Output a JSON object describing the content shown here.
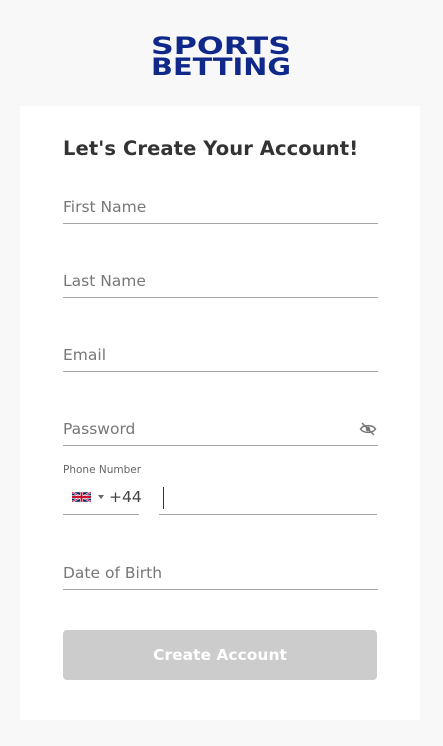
{
  "brand": {
    "logo_text_line1": "SPORTS",
    "logo_text_line2": "BETTING",
    "color": "#10288A"
  },
  "form": {
    "title": "Let's Create Your Account!",
    "fields": {
      "first_name": {
        "placeholder": "First Name",
        "value": ""
      },
      "last_name": {
        "placeholder": "Last Name",
        "value": ""
      },
      "email": {
        "placeholder": "Email",
        "value": ""
      },
      "password": {
        "placeholder": "Password",
        "value": "",
        "toggle_icon": "eye-slash-icon"
      },
      "phone": {
        "label": "Phone Number",
        "country_code": "+44",
        "country_flag_icon": "uk-flag-icon",
        "value": ""
      },
      "date_of_birth": {
        "placeholder": "Date of Birth",
        "value": ""
      }
    },
    "submit_label": "Create Account",
    "submit_color": "#CCCCCC"
  }
}
